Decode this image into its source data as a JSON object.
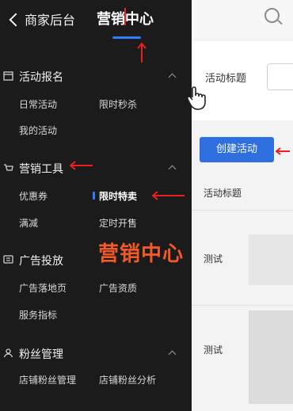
{
  "header": {
    "back_label": "商家后台",
    "title": "营销中心"
  },
  "sections": [
    {
      "title": "活动报名",
      "items": [
        "日常活动",
        "限时秒杀",
        "我的活动"
      ]
    },
    {
      "title": "营销工具",
      "items": [
        "优惠券",
        "限时特卖",
        "满减",
        "定时开售"
      ],
      "active_item": "限时特卖"
    },
    {
      "title": "广告投放",
      "items": [
        "广告落地页",
        "广告资质",
        "服务指标"
      ]
    },
    {
      "title": "粉丝管理",
      "items": [
        "店铺粉丝管理",
        "店铺粉丝分析"
      ]
    }
  ],
  "overlay": {
    "text": "营销中心"
  },
  "panel": {
    "field_label": "活动标题",
    "create_button": "创建活动",
    "column_label": "活动标题",
    "rows": [
      "测试",
      "测试"
    ]
  },
  "colors": {
    "accent": "#2f7cff",
    "annotation": "#e8201f",
    "overlay": "#f05a28"
  }
}
